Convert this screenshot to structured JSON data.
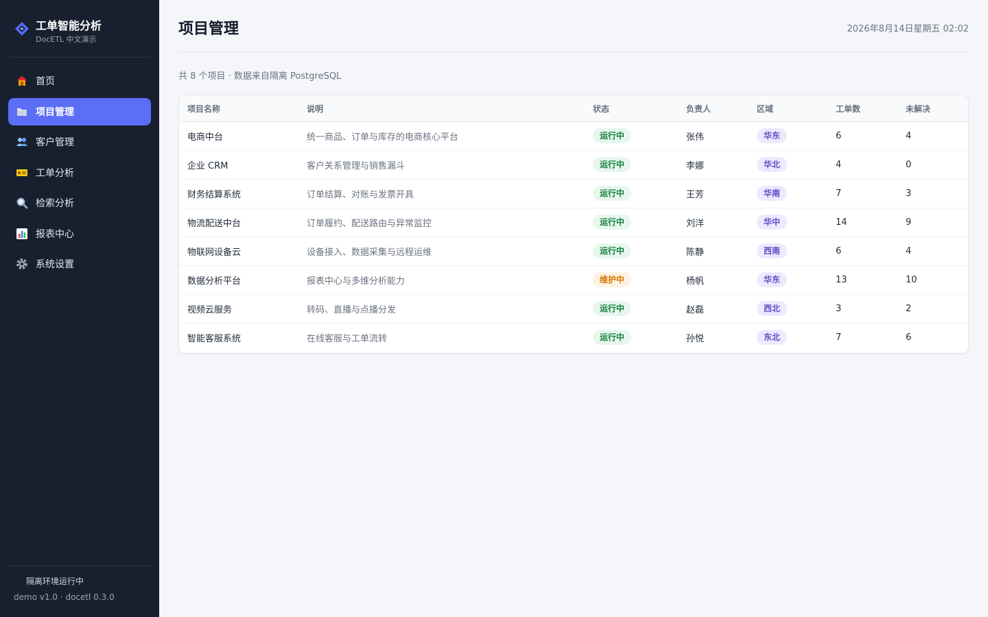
{
  "app": {
    "title": "工单智能分析",
    "subtitle": "DocETL 中文演示"
  },
  "nav": {
    "items": [
      {
        "label": "首页",
        "icon": "home-icon"
      },
      {
        "label": "项目管理",
        "icon": "folder-icon",
        "active": true
      },
      {
        "label": "客户管理",
        "icon": "users-icon"
      },
      {
        "label": "工单分析",
        "icon": "ticket-icon"
      },
      {
        "label": "检索分析",
        "icon": "search-icon"
      },
      {
        "label": "报表中心",
        "icon": "chart-icon"
      },
      {
        "label": "系统设置",
        "icon": "gear-icon"
      }
    ]
  },
  "footer": {
    "env_status": "隔离环境运行中",
    "version": "demo v1.0 · docetl 0.3.0"
  },
  "header": {
    "title": "项目管理",
    "datetime": "2026年8月14日星期五 02:02"
  },
  "summary": "共 8 个项目 · 数据来自隔离 PostgreSQL",
  "table": {
    "columns": [
      "项目名称",
      "说明",
      "状态",
      "负责人",
      "区域",
      "工单数",
      "未解决"
    ],
    "rows": [
      {
        "name": "电商中台",
        "desc": "统一商品、订单与库存的电商核心平台",
        "status": "运行中",
        "owner": "张伟",
        "region": "华东",
        "tickets": "6",
        "open": "4"
      },
      {
        "name": "企业 CRM",
        "desc": "客户关系管理与销售漏斗",
        "status": "运行中",
        "owner": "李娜",
        "region": "华北",
        "tickets": "4",
        "open": "0"
      },
      {
        "name": "财务结算系统",
        "desc": "订单结算、对账与发票开具",
        "status": "运行中",
        "owner": "王芳",
        "region": "华南",
        "tickets": "7",
        "open": "3"
      },
      {
        "name": "物流配送中台",
        "desc": "订单履约、配送路由与异常监控",
        "status": "运行中",
        "owner": "刘洋",
        "region": "华中",
        "tickets": "14",
        "open": "9"
      },
      {
        "name": "物联网设备云",
        "desc": "设备接入、数据采集与远程运维",
        "status": "运行中",
        "owner": "陈静",
        "region": "西南",
        "tickets": "6",
        "open": "4"
      },
      {
        "name": "数据分析平台",
        "desc": "报表中心与多维分析能力",
        "status": "维护中",
        "owner": "杨帆",
        "region": "华东",
        "tickets": "13",
        "open": "10"
      },
      {
        "name": "视频云服务",
        "desc": "转码、直播与点播分发",
        "status": "运行中",
        "owner": "赵磊",
        "region": "西北",
        "tickets": "3",
        "open": "2"
      },
      {
        "name": "智能客服系统",
        "desc": "在线客服与工单流转",
        "status": "运行中",
        "owner": "孙悦",
        "region": "东北",
        "tickets": "7",
        "open": "6"
      }
    ]
  },
  "colors": {
    "sidebar_bg": "#18202f",
    "accent": "#5b6ef5",
    "running": "#15803d",
    "maintenance": "#d97706",
    "region": "#5b4fc7"
  }
}
